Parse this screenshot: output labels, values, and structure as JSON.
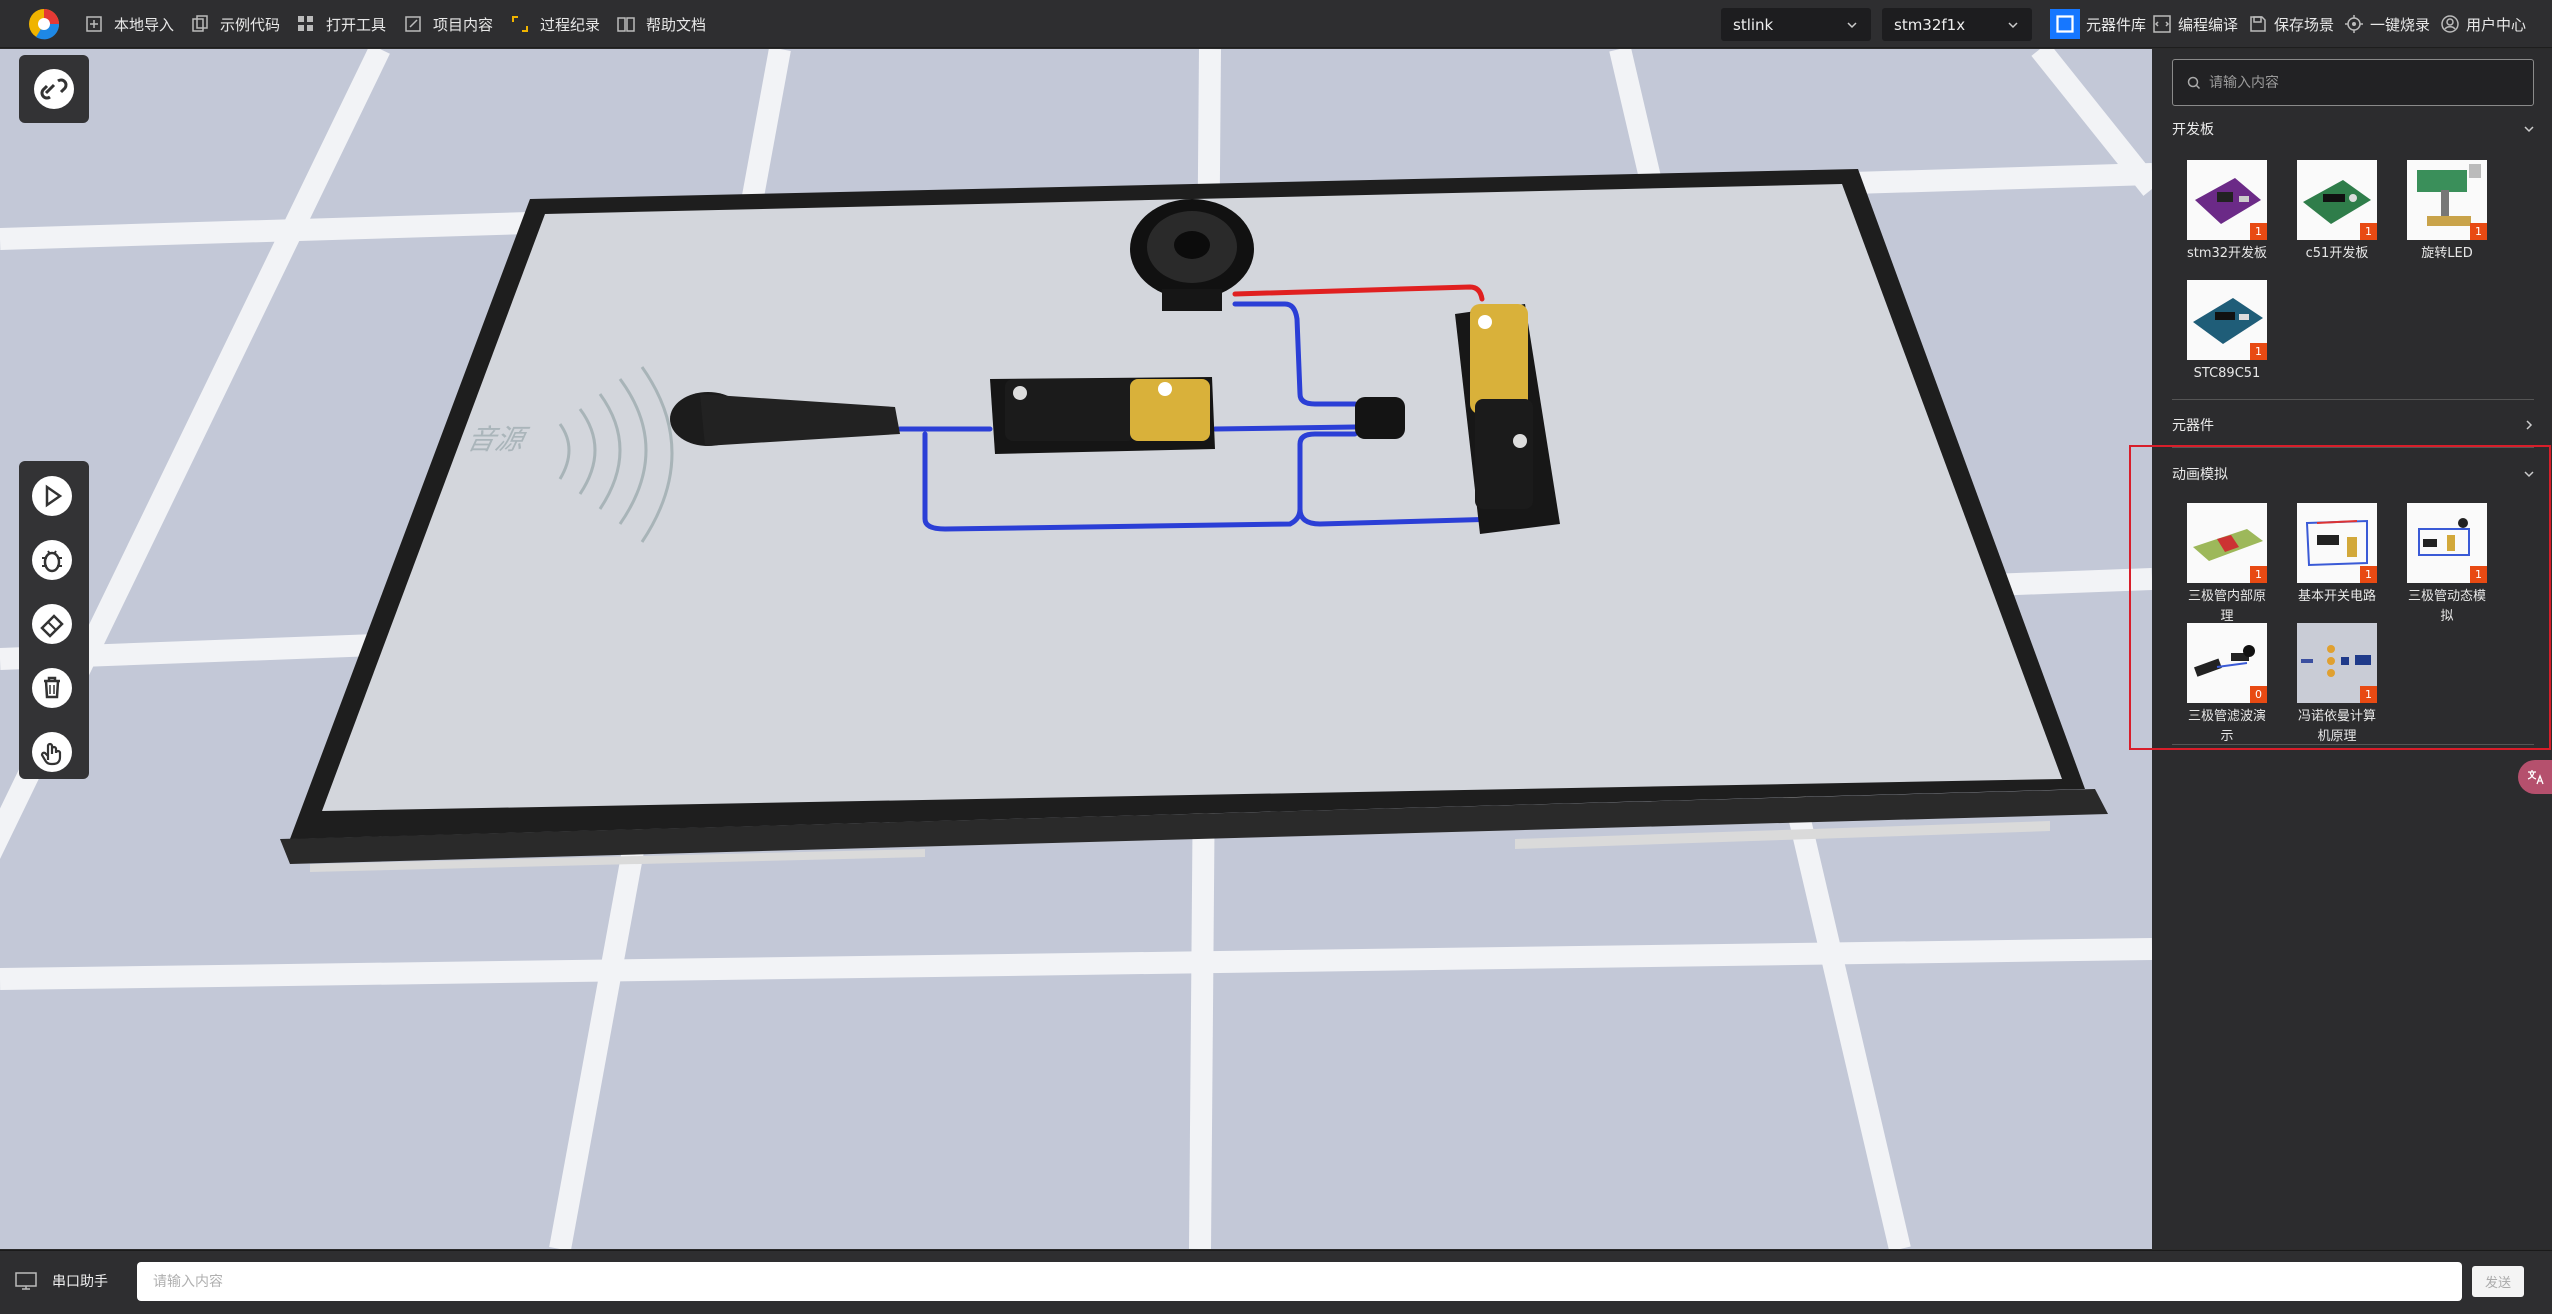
{
  "toolbar": {
    "items": [
      {
        "label": "本地导入",
        "icon": "import-icon"
      },
      {
        "label": "示例代码",
        "icon": "copy-icon"
      },
      {
        "label": "打开工具",
        "icon": "grid-icon"
      },
      {
        "label": "项目内容",
        "icon": "edit-icon"
      },
      {
        "label": "过程纪录",
        "icon": "record-icon"
      },
      {
        "label": "帮助文档",
        "icon": "book-icon"
      }
    ],
    "debugger_select": "stlink",
    "target_select": "stm32f1x",
    "right_items": [
      {
        "label": "元器件库",
        "icon": "chip-icon"
      },
      {
        "label": "编程编译",
        "icon": "code-icon"
      },
      {
        "label": "保存场景",
        "icon": "save-icon"
      },
      {
        "label": "一键烧录",
        "icon": "burn-icon"
      },
      {
        "label": "用户中心",
        "icon": "user-icon"
      }
    ]
  },
  "scene": {
    "sound_source_label": "音源"
  },
  "tools": {
    "link": "link-icon",
    "run": "play-icon",
    "debug": "bug-icon",
    "clean": "eraser-icon",
    "delete": "trash-icon",
    "interact": "hand-icon"
  },
  "sidebar": {
    "search_placeholder": "请输入内容",
    "sections": [
      {
        "title": "开发板",
        "expanded": true,
        "cards": [
          {
            "label": "stm32开发板",
            "count": "1"
          },
          {
            "label": "c51开发板",
            "count": "1"
          },
          {
            "label": "旋转LED",
            "count": "1"
          },
          {
            "label": "STC89C51",
            "count": "1"
          }
        ]
      },
      {
        "title": "元器件",
        "expanded": false,
        "cards": []
      },
      {
        "title": "动画模拟",
        "expanded": true,
        "cards": [
          {
            "label": "三极管内部原理",
            "count": "1"
          },
          {
            "label": "基本开关电路",
            "count": "1"
          },
          {
            "label": "三极管动态模拟",
            "count": "1"
          },
          {
            "label": "三极管滤波演示",
            "count": "0"
          },
          {
            "label": "冯诺依曼计算机原理",
            "count": "1"
          }
        ]
      }
    ]
  },
  "bottom": {
    "serial_label": "串口助手",
    "input_placeholder": "请输入内容",
    "send_label": "发送"
  },
  "colors": {
    "accent": "#1677ff",
    "badge": "#e84a13",
    "highlight": "#d81e2a",
    "wire_blue": "#2b3fd6",
    "wire_red": "#e02020"
  }
}
